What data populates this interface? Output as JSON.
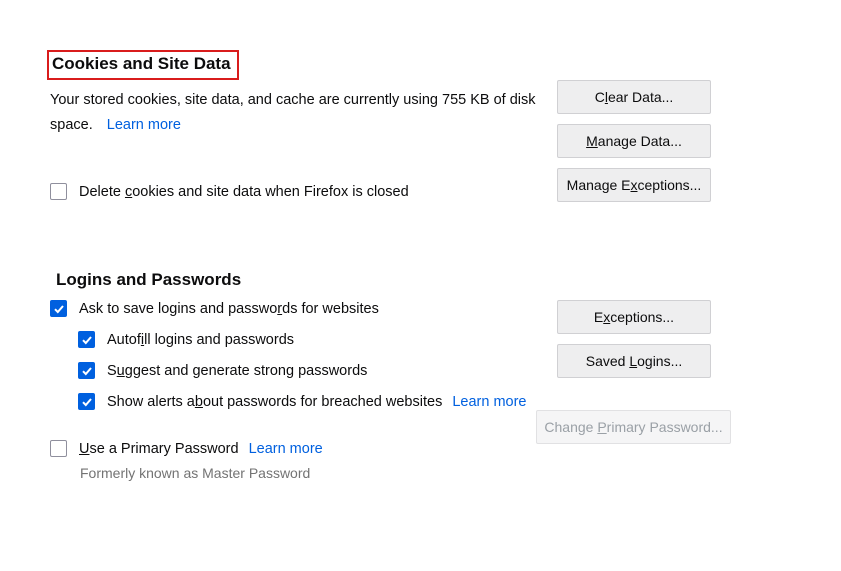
{
  "cookies": {
    "heading": "Cookies and Site Data",
    "desc_prefix": "Your stored cookies, site data, and cache are currently using ",
    "usage": "755 KB",
    "desc_suffix": " of disk space.",
    "learn_more": "Learn more",
    "delete_on_close": "Delete cookies and site data when Firefox is closed",
    "btn_clear": "Clear Data...",
    "btn_manage": "Manage Data...",
    "btn_exceptions": "Manage Exceptions..."
  },
  "logins": {
    "heading": "Logins and Passwords",
    "ask_save": "Ask to save logins and passwords for websites",
    "autofill": "Autofill logins and passwords",
    "suggest": "Suggest and generate strong passwords",
    "alerts": "Show alerts about passwords for breached websites",
    "alerts_learn_more": "Learn more",
    "primary": "Use a Primary Password",
    "primary_learn_more": "Learn more",
    "btn_exceptions": "Exceptions...",
    "btn_saved": "Saved Logins...",
    "btn_change_primary": "Change Primary Password...",
    "note": "Formerly known as Master Password"
  }
}
